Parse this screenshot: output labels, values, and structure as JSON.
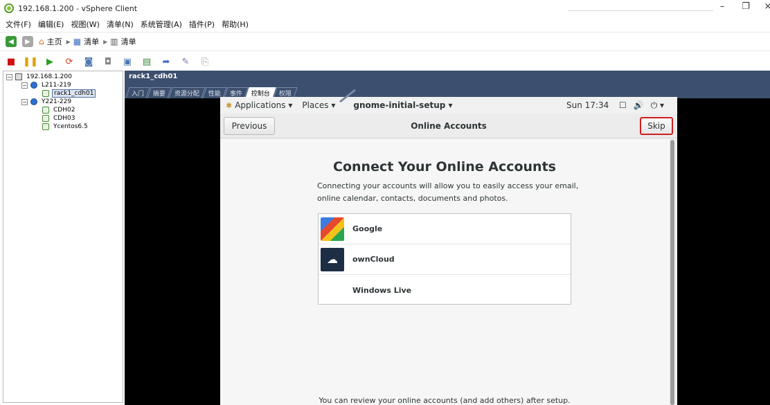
{
  "window": {
    "title": "192.168.1.200 - vSphere Client",
    "minimize": "–",
    "restore": "❐",
    "close": "×"
  },
  "menu": [
    "文件(F)",
    "编辑(E)",
    "视图(W)",
    "清单(N)",
    "系统管理(A)",
    "插件(P)",
    "帮助(H)"
  ],
  "nav": {
    "home": "主页",
    "crumb1": "清单",
    "crumb2": "清单"
  },
  "tree": {
    "root": "192.168.1.200",
    "cluster1": "L211-219",
    "vm_selected": "rack1_cdh01",
    "cluster2": "Y221-229",
    "vm2": "CDH02",
    "vm3": "CDH03",
    "vm4": "Ycentos6.5"
  },
  "pane": {
    "title": "rack1_cdh01",
    "tabs": [
      "入门",
      "摘要",
      "资源分配",
      "性能",
      "事件",
      "控制台",
      "权限"
    ],
    "active_tab": "控制台"
  },
  "guest": {
    "topbar": {
      "applications": "Applications ▾",
      "places": "Places ▾",
      "app_name": "gnome-initial-setup ▾",
      "clock": "Sun 17:34"
    },
    "header": {
      "previous": "Previous",
      "title": "Online Accounts",
      "skip": "Skip"
    },
    "heading": "Connect Your Online Accounts",
    "description": "Connecting your accounts will allow you to easily access your email, online calendar, contacts, documents and photos.",
    "accounts": [
      "Google",
      "ownCloud",
      "Windows Live"
    ],
    "footer": "You can review your online accounts (and add others) after setup."
  },
  "colors": {
    "pane_header": "#3c4f6e",
    "skip_highlight": "#d02020"
  }
}
